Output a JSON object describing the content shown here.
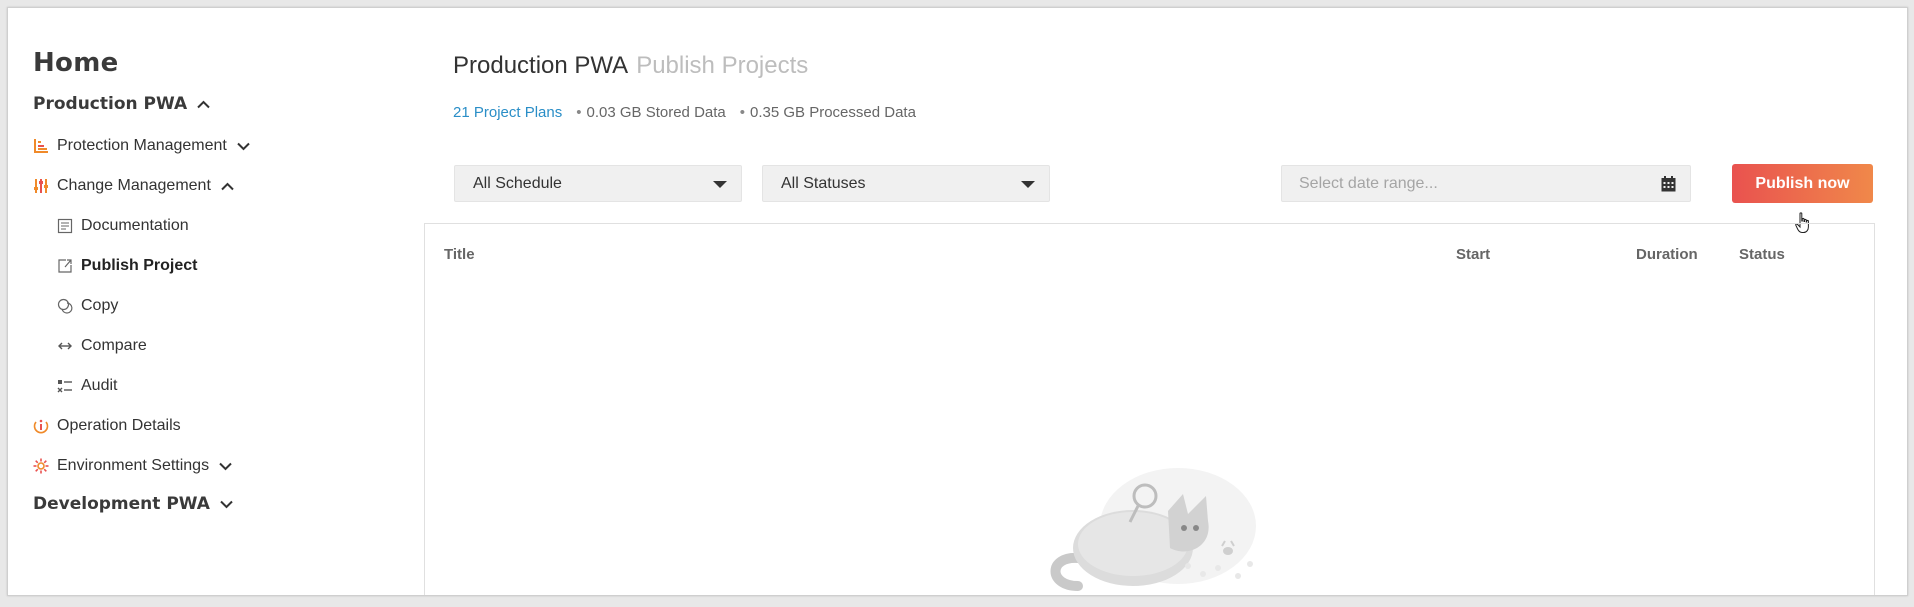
{
  "sidebar": {
    "home": "Home",
    "env1": "Production PWA",
    "protection": "Protection Management",
    "change": "Change Management",
    "sub": {
      "documentation": "Documentation",
      "publish": "Publish Project",
      "copy": "Copy",
      "compare": "Compare",
      "audit": "Audit"
    },
    "operation": "Operation Details",
    "environment": "Environment Settings",
    "env2": "Development PWA"
  },
  "header": {
    "title": "Production PWA",
    "subtitle": "Publish Projects",
    "stats": {
      "plans": "21 Project Plans",
      "stored": "0.03 GB Stored Data",
      "processed": "0.35 GB Processed Data"
    }
  },
  "filters": {
    "schedule": "All Schedule",
    "statuses": "All Statuses",
    "date_placeholder": "Select date range...",
    "publish_label": "Publish now"
  },
  "table": {
    "columns": [
      "Title",
      "Start",
      "Duration",
      "Status"
    ]
  },
  "colors": {
    "accent_link": "#2a8ec7",
    "publish_from": "#e9524f",
    "publish_to": "#f0884a"
  },
  "icons": {
    "protection": "bar-chart-icon",
    "change": "sliders-icon",
    "documentation": "document-icon",
    "publish": "publish-icon",
    "copy": "copy-icon",
    "compare": "compare-arrows-icon",
    "audit": "audit-icon",
    "operation": "info-icon",
    "environment": "gear-icon",
    "calendar": "calendar-icon"
  }
}
